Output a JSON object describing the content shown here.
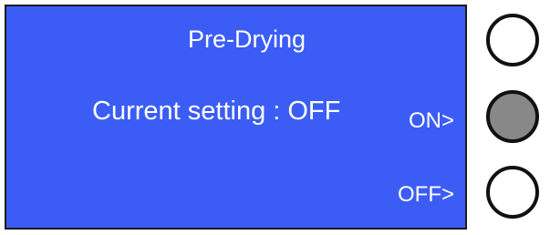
{
  "screen": {
    "title": "Pre-Drying",
    "current_setting": "Current setting : OFF",
    "option_on": "ON>",
    "option_off": "OFF>"
  },
  "colors": {
    "screen_background": "#3b5df5",
    "text": "#ffffff",
    "button_fill_top": "#ffffff",
    "button_fill_middle": "#888888",
    "button_fill_bottom": "#ffffff"
  }
}
